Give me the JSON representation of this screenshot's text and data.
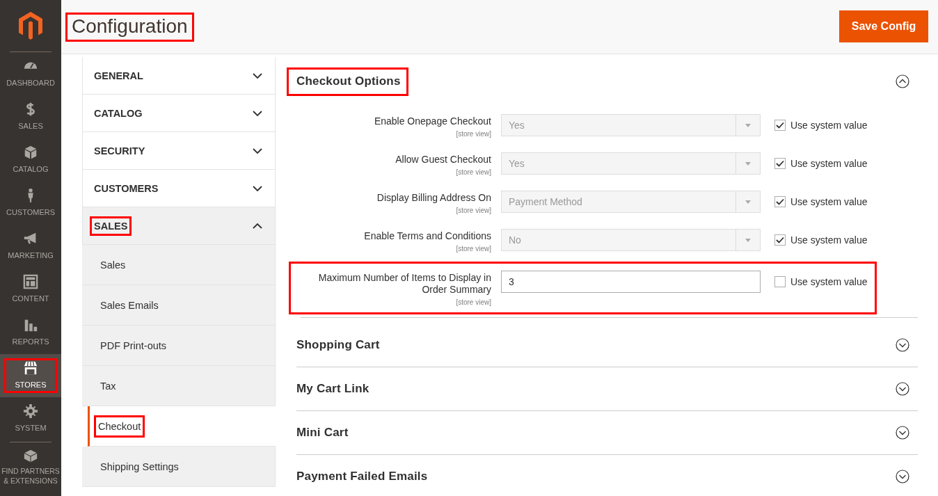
{
  "nav": {
    "items": [
      {
        "label": "DASHBOARD",
        "kind": "dashboard",
        "selected": false,
        "highlighted": false
      },
      {
        "label": "SALES",
        "kind": "dollar",
        "selected": false,
        "highlighted": false
      },
      {
        "label": "CATALOG",
        "kind": "box",
        "selected": false,
        "highlighted": false
      },
      {
        "label": "CUSTOMERS",
        "kind": "person",
        "selected": false,
        "highlighted": false
      },
      {
        "label": "MARKETING",
        "kind": "megaphone",
        "selected": false,
        "highlighted": false
      },
      {
        "label": "CONTENT",
        "kind": "layout",
        "selected": false,
        "highlighted": false
      },
      {
        "label": "REPORTS",
        "kind": "bars",
        "selected": false,
        "highlighted": false
      },
      {
        "label": "STORES",
        "kind": "store",
        "selected": true,
        "highlighted": true
      },
      {
        "label": "SYSTEM",
        "kind": "gear",
        "selected": false,
        "highlighted": false
      },
      {
        "label": "FIND PARTNERS & EXTENSIONS",
        "kind": "bricks",
        "selected": false,
        "highlighted": false
      }
    ]
  },
  "header": {
    "title": "Configuration",
    "highlighted": true,
    "save_button": "Save Config"
  },
  "config_tabs": [
    {
      "label": "GENERAL",
      "expanded": false,
      "highlighted": false
    },
    {
      "label": "CATALOG",
      "expanded": false,
      "highlighted": false
    },
    {
      "label": "SECURITY",
      "expanded": false,
      "highlighted": false
    },
    {
      "label": "CUSTOMERS",
      "expanded": false,
      "highlighted": false
    },
    {
      "label": "SALES",
      "expanded": true,
      "highlighted": true,
      "children": [
        {
          "label": "Sales",
          "selected": false,
          "highlighted": false
        },
        {
          "label": "Sales Emails",
          "selected": false,
          "highlighted": false
        },
        {
          "label": "PDF Print-outs",
          "selected": false,
          "highlighted": false
        },
        {
          "label": "Tax",
          "selected": false,
          "highlighted": false
        },
        {
          "label": "Checkout",
          "selected": true,
          "highlighted": true
        },
        {
          "label": "Shipping Settings",
          "selected": false,
          "highlighted": false
        }
      ]
    }
  ],
  "sections": [
    {
      "title": "Checkout Options",
      "expanded": true,
      "highlighted": true,
      "fields": [
        {
          "label": "Enable Onepage Checkout",
          "scope": "[store view]",
          "kind": "select",
          "value": "Yes",
          "disabled": true,
          "use_system_value": true,
          "checkbox_label": "Use system value",
          "highlighted": false
        },
        {
          "label": "Allow Guest Checkout",
          "scope": "[store view]",
          "kind": "select",
          "value": "Yes",
          "disabled": true,
          "use_system_value": true,
          "checkbox_label": "Use system value",
          "highlighted": false
        },
        {
          "label": "Display Billing Address On",
          "scope": "[store view]",
          "kind": "select",
          "value": "Payment Method",
          "disabled": true,
          "use_system_value": true,
          "checkbox_label": "Use system value",
          "highlighted": false
        },
        {
          "label": "Enable Terms and Conditions",
          "scope": "[store view]",
          "kind": "select",
          "value": "No",
          "disabled": true,
          "use_system_value": true,
          "checkbox_label": "Use system value",
          "highlighted": false
        },
        {
          "label": "Maximum Number of Items to Display in Order Summary",
          "scope": "[store view]",
          "kind": "text",
          "value": "3",
          "disabled": false,
          "use_system_value": false,
          "checkbox_label": "Use system value",
          "highlighted": true
        }
      ]
    },
    {
      "title": "Shopping Cart",
      "expanded": false,
      "highlighted": false
    },
    {
      "title": "My Cart Link",
      "expanded": false,
      "highlighted": false
    },
    {
      "title": "Mini Cart",
      "expanded": false,
      "highlighted": false
    },
    {
      "title": "Payment Failed Emails",
      "expanded": false,
      "highlighted": false
    }
  ]
}
